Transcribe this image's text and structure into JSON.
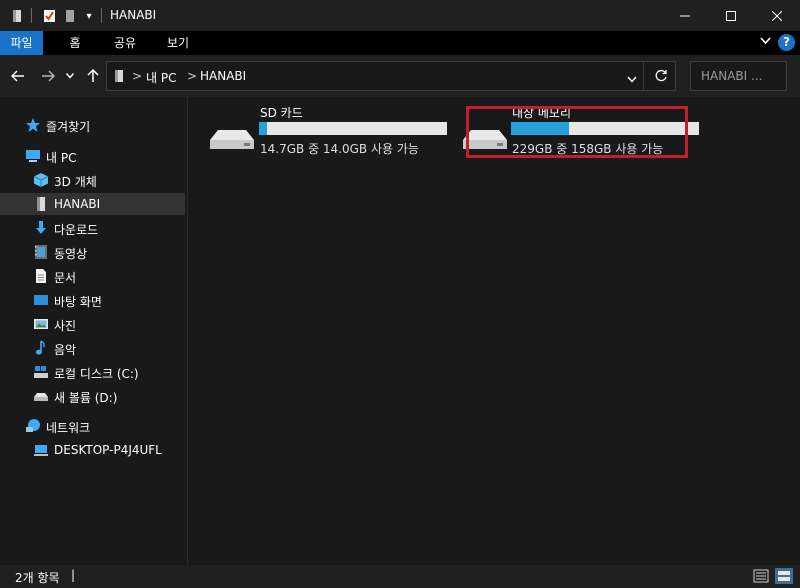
{
  "window": {
    "title": "HANABI",
    "controls": {
      "minimize": "minimize-icon",
      "maximize": "maximize-icon",
      "close": "close-icon"
    }
  },
  "ribbon": {
    "tabs": [
      "파일",
      "홈",
      "공유",
      "보기"
    ],
    "active_tab": "파일",
    "accent": "#1a73c8",
    "help": "?"
  },
  "address": {
    "path": [
      "내 PC",
      "HANABI"
    ],
    "separator": ">"
  },
  "search": {
    "placeholder": "HANABI ..."
  },
  "nav": {
    "quick_access": "즐겨찾기",
    "this_pc": "내 PC",
    "pc_items": [
      "3D 개체",
      "HANABI",
      "다운로드",
      "동영상",
      "문서",
      "바탕 화면",
      "사진",
      "음악",
      "로컬 디스크 (C:)",
      "새 볼륨 (D:)"
    ],
    "network": "네트워크",
    "network_items": [
      "DESKTOP-P4J4UFL"
    ],
    "selected": "HANABI"
  },
  "drives": [
    {
      "name": "SD 카드",
      "info": "14.7GB 중 14.0GB 사용 가능",
      "used_fraction": 0.04
    },
    {
      "name": "내장 메모리",
      "info": "229GB 중 158GB 사용 가능",
      "used_fraction": 0.31
    }
  ],
  "drive_bar_color": "#26a0da",
  "highlight_color": "#c0202b",
  "status": {
    "item_count": "2개 항목"
  }
}
